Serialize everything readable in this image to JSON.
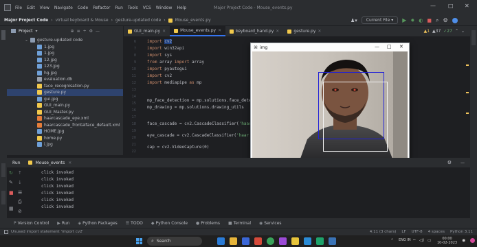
{
  "menu": [
    "File",
    "Edit",
    "View",
    "Navigate",
    "Code",
    "Refactor",
    "Run",
    "Tools",
    "VCS",
    "Window",
    "Help"
  ],
  "window_title": "Major Project Code - Mouse_events.py",
  "window_controls": {
    "minimize": "—",
    "maximize": "□",
    "close": "✕"
  },
  "breadcrumbs": {
    "project": "Major Project Code",
    "items": [
      "virtual keyboard & Mouse",
      "gesture-updated code",
      "Mouse_events.py"
    ]
  },
  "run_config": "Current File",
  "project_panel": {
    "title": "Project",
    "root": "gesture-updated code",
    "files": [
      {
        "name": "1.jpg",
        "color": "#6fa0d8"
      },
      {
        "name": "1.jpg",
        "color": "#6fa0d8"
      },
      {
        "name": "12.jpg",
        "color": "#6fa0d8"
      },
      {
        "name": "123.jpg",
        "color": "#6fa0d8"
      },
      {
        "name": "hg.jpg",
        "color": "#6fa0d8"
      },
      {
        "name": "evaluation.db",
        "color": "#9aa1ad"
      },
      {
        "name": "face_recognisation.py",
        "color": "#f2c94c"
      },
      {
        "name": "gesture.py",
        "color": "#f2c94c"
      },
      {
        "name": "gui.jpg",
        "color": "#6fa0d8"
      },
      {
        "name": "GUI_main.py",
        "color": "#f2c94c"
      },
      {
        "name": "GUI_Master.py",
        "color": "#f2c94c"
      },
      {
        "name": "haarcascade_eye.xml",
        "color": "#e57d3a"
      },
      {
        "name": "haarcascade_frontalface_default.xml",
        "color": "#e57d3a"
      },
      {
        "name": "HOME.jpg",
        "color": "#6fa0d8"
      },
      {
        "name": "home.py",
        "color": "#f2c94c"
      },
      {
        "name": "i.jpg",
        "color": "#6fa0d8"
      }
    ],
    "selected_index": 7
  },
  "tabs": [
    {
      "label": "GUI_main.py",
      "active": false
    },
    {
      "label": "Mouse_events.py",
      "active": true
    },
    {
      "label": "keyboard_hand.py",
      "active": false
    },
    {
      "label": "gesture.py",
      "active": false
    }
  ],
  "inspection": {
    "warnings": "▲1",
    "weak": "▲37",
    "typos": "✓27"
  },
  "line_numbers": [
    "6",
    "7",
    "8",
    "9",
    "10",
    "11",
    "12",
    "13",
    "14",
    "15",
    "16",
    "17",
    "18",
    "19",
    "20",
    "21",
    "22"
  ],
  "code": {
    "l1a": "import ",
    "l1b": "cv2",
    "l2a": "import ",
    "l2b": "win32api",
    "l3a": "import ",
    "l3b": "sys",
    "l4a": "from ",
    "l4b": "array ",
    "l4c": "import ",
    "l4d": "array",
    "l5a": "import ",
    "l5b": "pyautogui",
    "l6a": "import ",
    "l6b": "cv2",
    "l7a": "import ",
    "l7b": "mediapipe ",
    "l7c": "as ",
    "l7d": "mp",
    "l8": "mp_face_detection = mp.solutions.face_dete",
    "l9": "mp_drawing = mp.solutions.drawing_utils",
    "l10a": "face_cascade = cv2.CascadeClassifier(",
    "l10b": "'haar",
    "l11a": "eye_cascade = cv2.CascadeClassifier(",
    "l11b": "'haar",
    "l12": "cap = cv2.VideoCapture(0)"
  },
  "img_window": {
    "title": "img",
    "box_outer_color": "#1f1fd8",
    "box_inner_color": "#f2f2f2"
  },
  "run_panel": {
    "label": "Run",
    "config": "Mouse_events"
  },
  "console_lines": [
    "click invoked",
    "click invoked",
    "click invoked",
    "click invoked",
    "click invoked",
    "click invoked"
  ],
  "tool_tabs": [
    {
      "icon": "P",
      "label": "Version Control"
    },
    {
      "icon": "▶",
      "label": "Run"
    },
    {
      "icon": "◈",
      "label": "Python Packages"
    },
    {
      "icon": "☰",
      "label": "TODO"
    },
    {
      "icon": "◆",
      "label": "Python Console"
    },
    {
      "icon": "●",
      "label": "Problems"
    },
    {
      "icon": "■",
      "label": "Terminal"
    },
    {
      "icon": "◉",
      "label": "Services"
    }
  ],
  "status": {
    "message": "Unused import statement 'import cv2'",
    "position": "4:11 (3 chars)",
    "line_sep": "LF",
    "encoding": "UTF-8",
    "indent": "4 spaces",
    "interpreter": "Python 3.11"
  },
  "taskbar": {
    "search_placeholder": "Search",
    "lang": "ENG IN",
    "time": "00:00",
    "date": "10-02-2023"
  }
}
